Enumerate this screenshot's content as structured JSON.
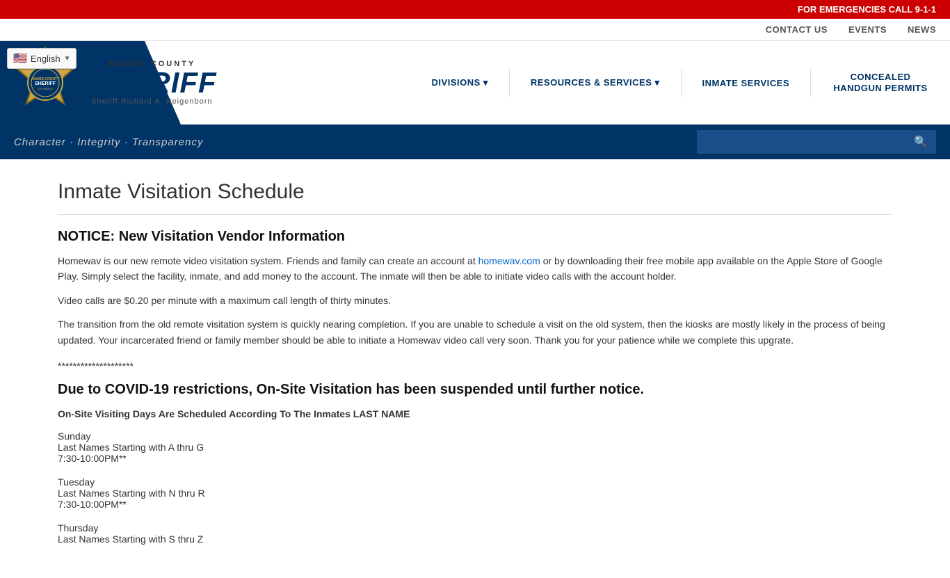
{
  "emergency": {
    "text": "FOR EMERGENCIES CALL 9-1-1"
  },
  "topnav": {
    "links": [
      {
        "label": "CONTACT US",
        "id": "contact-us"
      },
      {
        "label": "EVENTS",
        "id": "events"
      },
      {
        "label": "NEWS",
        "id": "news"
      }
    ]
  },
  "lang": {
    "label": "English",
    "flag": "🇺🇸",
    "arrow": "▼"
  },
  "header": {
    "adams_county": "ADAMS COUNTY",
    "sheriff": "SHERIFF",
    "sheriff_name": "Sheriff Richard A. Reigenborn"
  },
  "mainnav": {
    "items": [
      {
        "label": "DIVISIONS ▾",
        "id": "divisions"
      },
      {
        "label": "RESOURCES & SERVICES ▾",
        "id": "resources"
      },
      {
        "label": "INMATE SERVICES",
        "id": "inmate-services"
      },
      {
        "label": "CONCEALED HANDGUN PERMITS",
        "id": "concealed-handgun"
      }
    ]
  },
  "tagline": {
    "text": "Character · Integrity · Transparency"
  },
  "search": {
    "placeholder": ""
  },
  "content": {
    "page_title": "Inmate Visitation Schedule",
    "notice_title": "NOTICE: New Visitation Vendor Information",
    "notice_p1_pre": "Homewav is our new remote video visitation system. Friends and family can create an account at ",
    "notice_link": "homewav.com",
    "notice_p1_post": " or by downloading their free mobile app available on the Apple Store of Google Play. Simply select the facility, inmate, and add money to the account. The inmate will then be able to initiate video calls with the account holder.",
    "notice_p2": "Video calls are $0.20 per minute with a maximum call length of thirty minutes.",
    "notice_p3": "The transition from the old remote visitation system is quickly nearing completion. If you are unable to schedule a visit on the old system, then the kiosks are mostly likely in the process of being updated. Your incarcerated friend or family member should be able to initiate a Homewav video call very soon. Thank you for your patience while we complete this upgrate.",
    "separator": "********************",
    "covid_title": "Due to COVID-19 restrictions, On-Site Visitation has been suspended until further notice.",
    "schedule_header": "On-Site Visiting Days Are Scheduled According To The Inmates LAST NAME",
    "schedule": [
      {
        "day": "Sunday",
        "names": "Last Names Starting with A thru G",
        "time": "7:30-10:00PM**"
      },
      {
        "day": "Tuesday",
        "names": "Last Names Starting with N thru R",
        "time": "7:30-10:00PM**"
      },
      {
        "day": "Thursday",
        "names": "Last Names Starting with S thru Z",
        "time": ""
      }
    ]
  }
}
